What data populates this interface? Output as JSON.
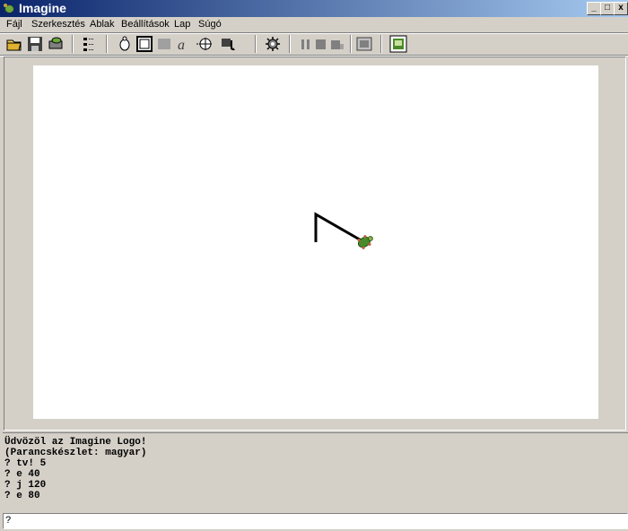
{
  "window": {
    "title": "Imagine",
    "minimize": "_",
    "maximize": "□",
    "close": "x"
  },
  "menu": [
    "Fájl",
    "Szerkesztés",
    "Ablak",
    "Beállítások",
    "Lap",
    "Súgó"
  ],
  "toolbar_icons": [
    "open-folder-icon",
    "save-disk-icon",
    "print-turtle-icon",
    "project-tree-icon",
    "new-turtle-icon",
    "frame-icon",
    "rectangle-icon",
    "text-tool-icon",
    "crosshair-icon",
    "button-tool-icon",
    "settings-gear-icon",
    "pause-icon",
    "stop-icon",
    "step-icon",
    "page-view-icon",
    "panel-toggle-icon"
  ],
  "console": {
    "lines": [
      "Üdvözöl az Imagine Logo!",
      "(Parancskészlet: magyar)",
      "? tv! 5",
      "? e 40",
      "? j 120",
      "? e 80"
    ]
  },
  "command": {
    "prompt": "?"
  },
  "colors": {
    "title_start": "#0a246a",
    "title_end": "#a6caf0",
    "turtle_shell": "#4a8a2a",
    "line": "#000000"
  }
}
